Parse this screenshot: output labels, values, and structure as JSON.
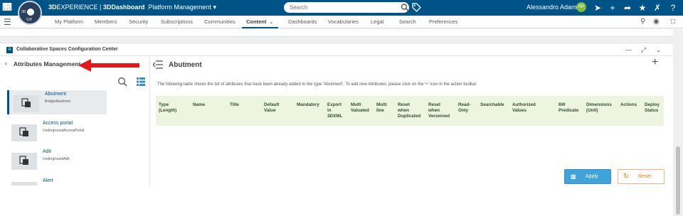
{
  "topbar": {
    "app_name_prefix": "3D",
    "app_name_mid": "EXPERIENCE | ",
    "app_name_bold": "3DDashboard",
    "dashboard": "Platform Management",
    "compass_version": "V,R",
    "compass_left": "3D",
    "search_placeholder": "Search",
    "user_name": "Alessandro Adami",
    "user_initials": "RP"
  },
  "nav": {
    "tabs": [
      "My Platform",
      "Members",
      "Security",
      "Subscriptions",
      "Communities",
      "Content",
      "Dashboards",
      "Vocabularies",
      "Legal",
      "Search",
      "Preferences"
    ],
    "active_tab": "Content"
  },
  "widget": {
    "title": "Collaborative Spaces Configuration Center"
  },
  "left_panel": {
    "title": "Attributes Management",
    "items": [
      {
        "name": "Abutment",
        "sub": "BridgeAbutment"
      },
      {
        "name": "Access portal",
        "sub": "UndergroundAccessPortal"
      },
      {
        "name": "Adit",
        "sub": "UndergroundAdit"
      },
      {
        "name": "Alert",
        "sub": ""
      }
    ]
  },
  "right_panel": {
    "title": "Abutment",
    "description": "The following table shows the list of attributes that have been already added to the type 'Abutment'. To add new Attributes, please click on the '+' icon in the action toolbar",
    "columns": [
      "Type\n(Length)",
      "Name",
      "Title",
      "Default\nValue",
      "Mandatory",
      "Export\nin\n3DXML",
      "Multi\nValuated",
      "Multi\nline",
      "Reset\nwhen\nDuplicated",
      "Reset\nwhen\nVersioned",
      "Read-\nOnly",
      "Searchable",
      "Authorized\nValues",
      "6W\nPredicate",
      "Dimensions\n(Unit)",
      "Actions",
      "Deploy\nStatus"
    ],
    "apply_label": "Apply",
    "reset_label": "Reset"
  },
  "colors": {
    "brand": "#005386",
    "table_header": "#edf5e1",
    "apply": "#42a2da",
    "reset": "#e87b1c",
    "annotation_arrow": "#e01a1a"
  }
}
